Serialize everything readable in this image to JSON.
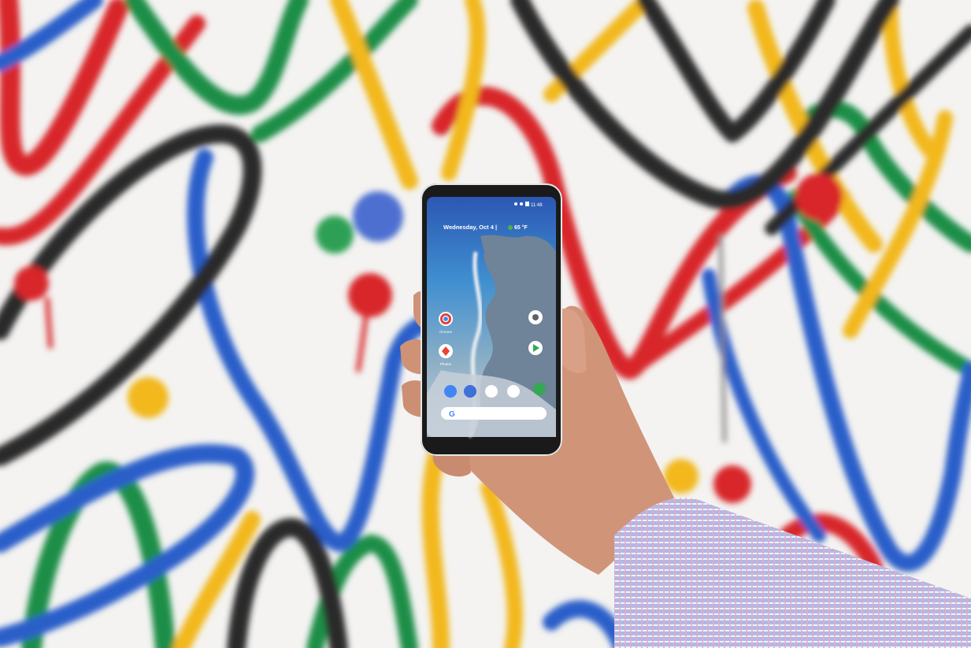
{
  "photo": {
    "wall_colors": {
      "background": "#f4f3f1",
      "red": "#d8282a",
      "green": "#1f8e47",
      "yellow": "#f2b81c",
      "blue": "#2b5fc9",
      "black": "#2b2b2b"
    }
  },
  "phone": {
    "status_bar": {
      "time": "11:48"
    },
    "date_widget": {
      "text": "Wednesday, Oct 4 |",
      "temperature": "65 °F"
    },
    "apps": [
      {
        "label": "Chrome",
        "icon": "chrome-icon"
      },
      {
        "label": "Photos",
        "icon": "photos-icon"
      },
      {
        "label": "",
        "icon": "camera-icon"
      },
      {
        "label": "",
        "icon": "play-store-icon"
      }
    ],
    "dock": [
      "phone-icon",
      "contacts-icon",
      "messages-icon",
      "photos-icon",
      "maps-icon"
    ],
    "search_icon": "google-g-icon",
    "colors": {
      "frame": "#1a1a1a",
      "sky": "#2f5bb5",
      "water": "#3aa0c8",
      "rock": "#6b7f98"
    }
  },
  "hand": {
    "skin": "#d49a7e",
    "sleeve": "#a7b6e3"
  }
}
